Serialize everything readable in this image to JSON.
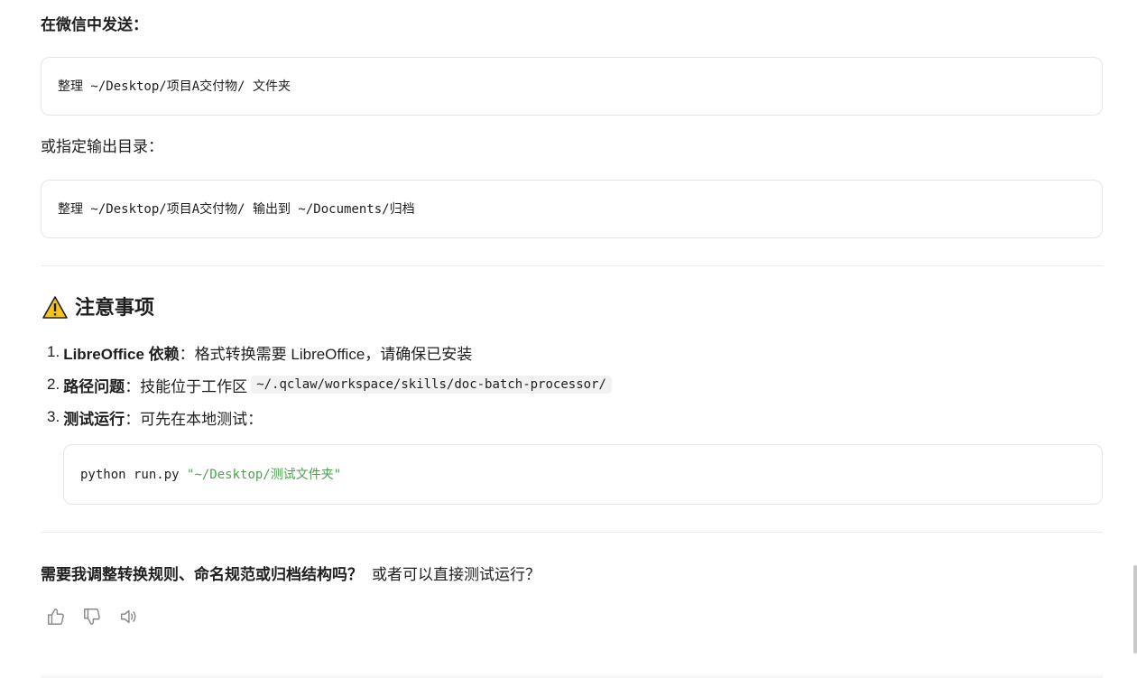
{
  "section1": {
    "send_label": "在微信中发送：",
    "code1": "整理 ~/Desktop/项目A交付物/ 文件夹",
    "alt_label": "或指定输出目录：",
    "code2": "整理 ~/Desktop/项目A交付物/ 输出到 ~/Documents/归档"
  },
  "notes": {
    "title": "注意事项",
    "items": [
      {
        "num": "1.",
        "bold": "LibreOffice 依赖",
        "text": "：格式转换需要 LibreOffice，请确保已安装"
      },
      {
        "num": "2.",
        "bold": "路径问题",
        "text": "：技能位于工作区",
        "code": "~/.qclaw/workspace/skills/doc-batch-processor/"
      },
      {
        "num": "3.",
        "bold": "测试运行",
        "text": "：可先在本地测试："
      }
    ],
    "code_cmd": "python run.py ",
    "code_arg": "\"~/Desktop/测试文件夹\""
  },
  "footer": {
    "question_bold": "需要我调整转换规则、命名规范或归档结构吗？",
    "question_rest": "或者可以直接测试运行？"
  },
  "icons": {
    "warning": "warning-icon",
    "like": "thumbs-up-icon",
    "dislike": "thumbs-down-icon",
    "speak": "speaker-icon"
  },
  "colors": {
    "warning_yellow": "#f5c518",
    "string_green": "#50a14f"
  }
}
